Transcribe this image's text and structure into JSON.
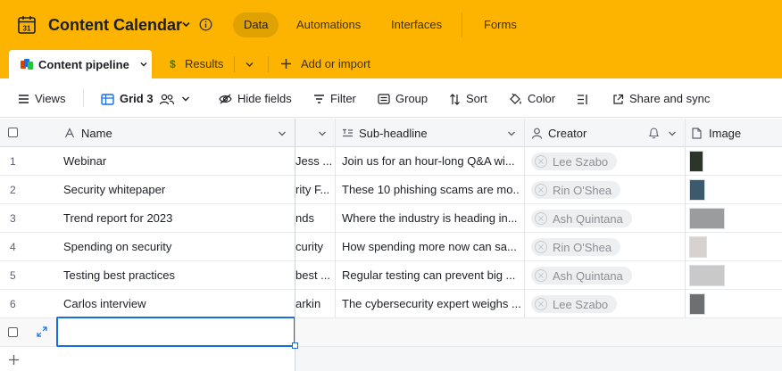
{
  "base": {
    "title": "Content Calendar",
    "icon": "calendar-icon",
    "calendar_day": "31"
  },
  "top_tabs": [
    {
      "label": "Data",
      "active": true
    },
    {
      "label": "Automations",
      "active": false
    },
    {
      "label": "Interfaces",
      "active": false
    },
    {
      "label": "Forms",
      "active": false
    }
  ],
  "table_tabs": {
    "active_label": "Content pipeline",
    "second_label": "Results",
    "second_symbol": "$",
    "add_label": "Add or import"
  },
  "toolbar": {
    "views_label": "Views",
    "grid_label": "Grid 3",
    "hide_fields_label": "Hide fields",
    "filter_label": "Filter",
    "group_label": "Group",
    "sort_label": "Sort",
    "color_label": "Color",
    "share_label": "Share and sync"
  },
  "columns": {
    "name": "Name",
    "sub_headline": "Sub-headline",
    "creator": "Creator",
    "image": "Image"
  },
  "rows": [
    {
      "num": "1",
      "name": "Webinar",
      "partial": "Jess ...",
      "sub_headline": "Join us for an hour-long Q&A wi...",
      "creator": "Lee Szabo",
      "thumbs": [
        "#2d3429"
      ]
    },
    {
      "num": "2",
      "name": "Security whitepaper",
      "partial": "rity F...",
      "sub_headline": "These 10 phishing scams are mo...",
      "creator": "Rin O'Shea",
      "thumbs": [
        "#3c5a6e"
      ]
    },
    {
      "num": "3",
      "name": "Trend report for 2023",
      "partial": "nds",
      "sub_headline": "Where the industry is heading in...",
      "creator": "Ash Quintana",
      "thumbs": [
        "#9a9c9e"
      ]
    },
    {
      "num": "4",
      "name": "Spending on security",
      "partial": "curity",
      "sub_headline": "How spending more now can sa...",
      "creator": "Rin O'Shea",
      "thumbs": [
        "#d8d2cf"
      ]
    },
    {
      "num": "5",
      "name": "Testing best practices",
      "partial": "best ...",
      "sub_headline": "Regular testing can prevent big ...",
      "creator": "Ash Quintana",
      "thumbs": [
        "#c9c9c9"
      ]
    },
    {
      "num": "6",
      "name": "Carlos interview",
      "partial": "arkin",
      "sub_headline": "The cybersecurity expert weighs ...",
      "creator": "Lee Szabo",
      "thumbs": [
        "#6d6f70"
      ]
    }
  ],
  "colors": {
    "topbar": "#fcb400",
    "accent": "#166ee1",
    "active_tab_pill": "#e0a200"
  }
}
